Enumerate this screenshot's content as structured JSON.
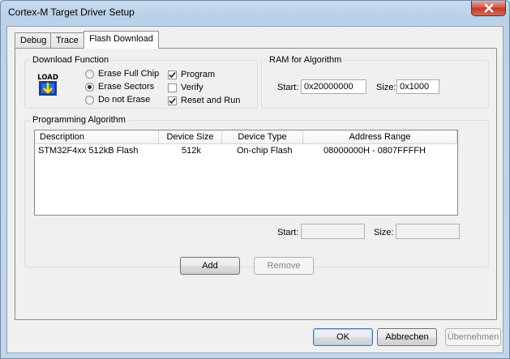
{
  "window": {
    "title": "Cortex-M Target Driver Setup"
  },
  "tabs": [
    {
      "label": "Debug"
    },
    {
      "label": "Trace"
    },
    {
      "label": "Flash Download"
    }
  ],
  "download_function": {
    "label": "Download Function",
    "load_icon_text": "LOAD",
    "radios": [
      {
        "label": "Erase Full Chip",
        "selected": false
      },
      {
        "label": "Erase Sectors",
        "selected": true
      },
      {
        "label": "Do not Erase",
        "selected": false
      }
    ],
    "checks": [
      {
        "label": "Program",
        "checked": true
      },
      {
        "label": "Verify",
        "checked": false
      },
      {
        "label": "Reset and Run",
        "checked": true
      }
    ]
  },
  "ram": {
    "label": "RAM for Algorithm",
    "start_label": "Start:",
    "start_value": "0x20000000",
    "size_label": "Size:",
    "size_value": "0x1000"
  },
  "algorithm": {
    "label": "Programming Algorithm",
    "columns": [
      "Description",
      "Device Size",
      "Device Type",
      "Address Range"
    ],
    "rows": [
      {
        "description": "STM32F4xx 512kB Flash",
        "size": "512k",
        "type": "On-chip Flash",
        "range": "08000000H - 0807FFFFH"
      }
    ],
    "start_label": "Start:",
    "start_value": "",
    "size_label": "Size:",
    "size_value": ""
  },
  "buttons": {
    "add": "Add",
    "remove": "Remove",
    "ok": "OK",
    "cancel": "Abbrechen",
    "apply": "Übernehmen"
  }
}
